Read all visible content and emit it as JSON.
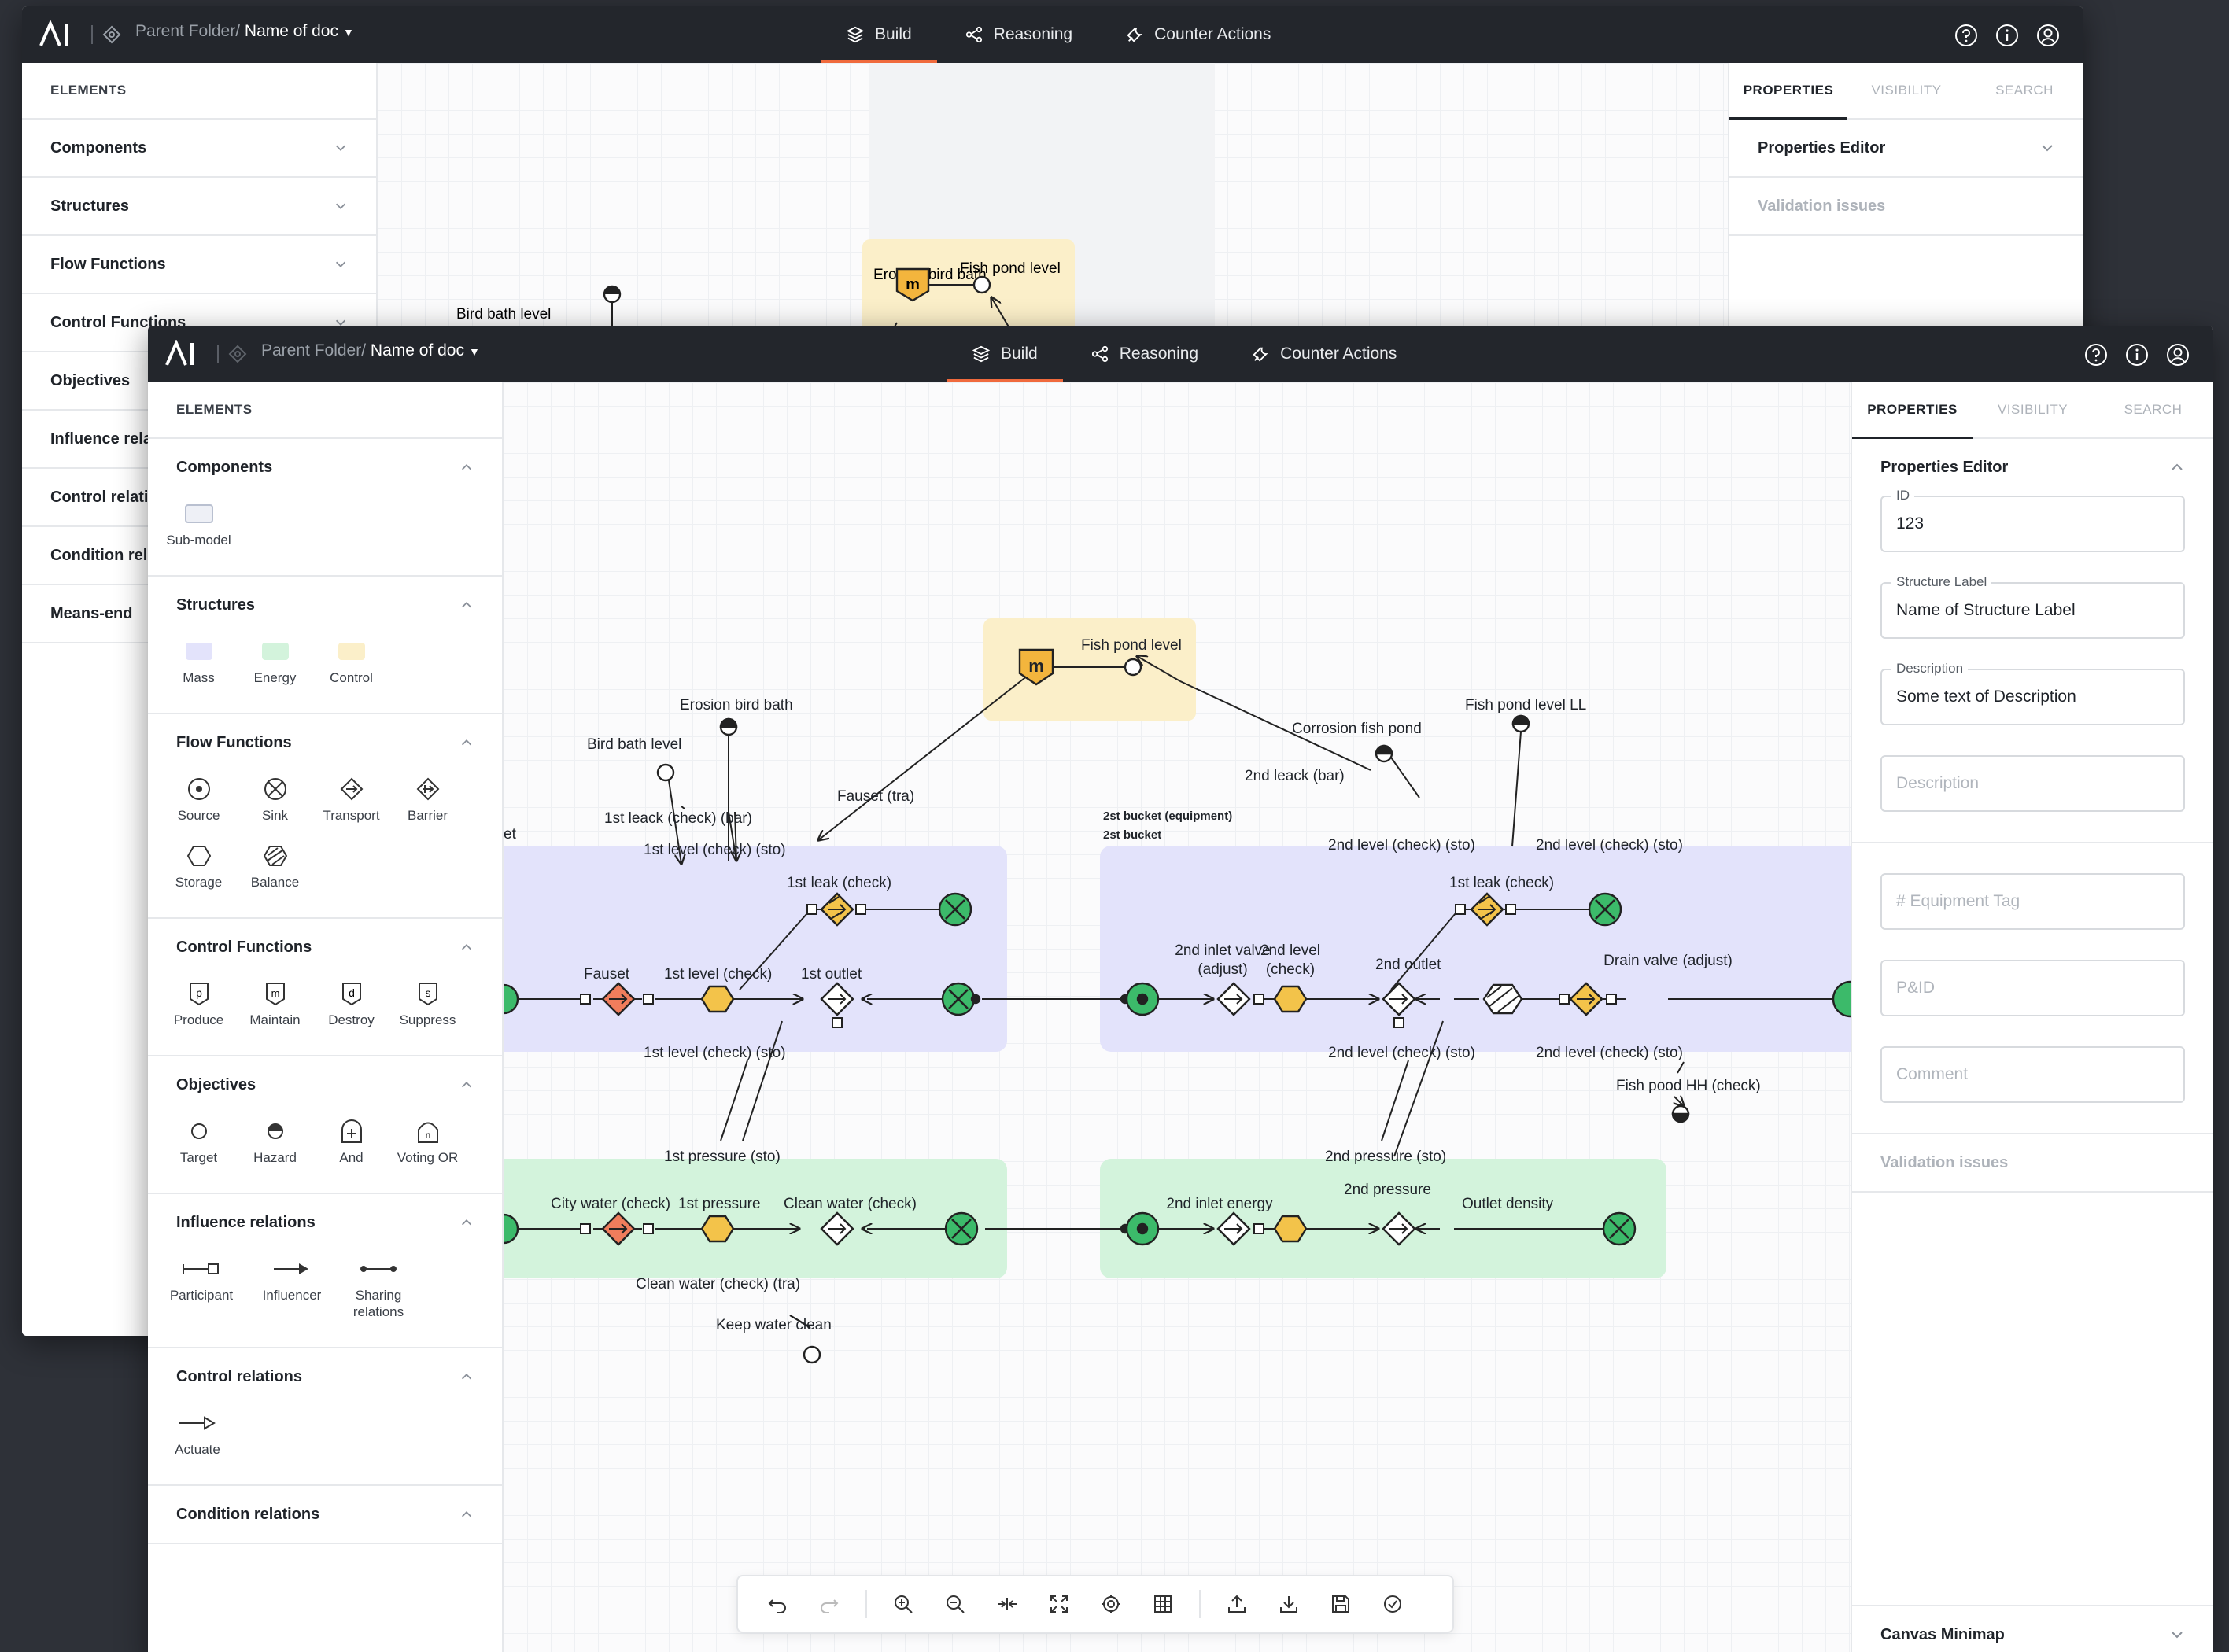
{
  "app": {
    "breadcrumb_parent": "Parent Folder/",
    "doc_name": "Name of doc"
  },
  "nav_tabs": [
    {
      "label": "Build",
      "active": true
    },
    {
      "label": "Reasoning",
      "active": false
    },
    {
      "label": "Counter Actions",
      "active": false
    }
  ],
  "header_icons": [
    "help-icon",
    "info-icon",
    "account-icon"
  ],
  "accent": "#f06a3d",
  "back_window": {
    "elements_title": "ELEMENTS",
    "sections": [
      "Components",
      "Structures",
      "Flow Functions",
      "Control Functions",
      "Objectives",
      "Influence rela",
      "Control relati",
      "Condition rela",
      "Means-end"
    ],
    "right_tabs": [
      "PROPERTIES",
      "VISIBILITY",
      "SEARCH"
    ],
    "properties_editor": "Properties Editor",
    "validation": "Validation issues",
    "canvas_labels": {
      "erosion": "Erosion bird bath",
      "bird_bath": "Bird bath level",
      "fish_pond": "Fish pond level"
    }
  },
  "left_panel": {
    "title": "ELEMENTS",
    "components": {
      "title": "Components",
      "items": [
        {
          "label": "Sub-model"
        }
      ]
    },
    "structures": {
      "title": "Structures",
      "items": [
        {
          "label": "Mass",
          "color": "#e3e3fb"
        },
        {
          "label": "Energy",
          "color": "#d3f3dc"
        },
        {
          "label": "Control",
          "color": "#fbefc9"
        }
      ]
    },
    "flow_functions": {
      "title": "Flow Functions",
      "items": [
        "Source",
        "Sink",
        "Transport",
        "Barrier",
        "Storage",
        "Balance"
      ]
    },
    "control_functions": {
      "title": "Control Functions",
      "items": [
        "Produce",
        "Maintain",
        "Destroy",
        "Suppress"
      ]
    },
    "objectives": {
      "title": "Objectives",
      "items": [
        "Target",
        "Hazard",
        "And",
        "Voting OR"
      ]
    },
    "influence_relations": {
      "title": "Influence relations",
      "items": [
        "Participant",
        "Influencer",
        "Sharing relations"
      ]
    },
    "control_relations": {
      "title": "Control relations",
      "items": [
        "Actuate"
      ]
    },
    "condition_relations": {
      "title": "Condition relations"
    }
  },
  "right_panel": {
    "tabs": [
      "PROPERTIES",
      "VISIBILITY",
      "SEARCH"
    ],
    "properties_editor": "Properties Editor",
    "fields": {
      "id": {
        "label": "ID",
        "value": "123"
      },
      "structure_label": {
        "label": "Structure Label",
        "value": "Name of Structure Label"
      },
      "description": {
        "label": "Description",
        "value": "Some text of Description"
      },
      "description2": {
        "placeholder": "Description"
      },
      "equipment_tag": {
        "placeholder": "# Equipment Tag"
      },
      "pid": {
        "placeholder": "P&ID"
      },
      "comment": {
        "placeholder": "Comment"
      }
    },
    "validation": "Validation issues",
    "minimap": "Canvas Minimap"
  },
  "canvas": {
    "fish_pond_level": "Fish pond level",
    "erosion_bird_bath": "Erosion bird bath",
    "bird_bath_level": "Bird bath level",
    "fauset_tra": "Fauset (tra)",
    "leak_bar_1": "1st leack (check) (bar)",
    "level_sto_1_top": "1st level (check) (sto)",
    "bucket_equipment": "2st bucket (equipment)",
    "bucket": "2st bucket",
    "corrosion": "Corrosion fish pond",
    "leak_bar_2": "2nd leack (bar)",
    "fish_pond_ll": "Fish pond level LL",
    "level_sto_2_top": "2nd level (check) (sto)",
    "level_sto_2_top_b": "2nd level (check) (sto)",
    "leak_check_1": "1st leak (check)",
    "fauset": "Fauset",
    "level_check_1": "1st level (check)",
    "outlet_1": "1st outlet",
    "leak_check_2": "1st leak (check)",
    "inlet_valve_2": "2nd inlet valve",
    "adjust": "(adjust)",
    "level_2": "2nd level",
    "check": "(check)",
    "outlet_2": "2nd outlet",
    "drain_valve": "Drain valve (adjust)",
    "level_sto_1_bottom": "1st level (check) (sto)",
    "level_sto_2_bottom": "2nd level (check) (sto)",
    "level_sto_2_bottom_b": "2nd level (check) (sto)",
    "fish_pond_hh": "Fish pood HH (check)",
    "pressure_sto_1": "1st pressure (sto)",
    "pressure_sto_2": "2nd pressure (sto)",
    "city_water": "City water (check)",
    "pressure_1": "1st pressure",
    "clean_water": "Clean water (check)",
    "inlet_energy": "2nd inlet energy",
    "pressure_2": "2nd pressure",
    "outlet_density": "Outlet density",
    "clean_water_tra": "Clean water (check) (tra)",
    "keep_water_clean": "Keep water clean",
    "edge_label": "et"
  },
  "toolbar": [
    "undo-icon",
    "redo-icon",
    "zoom-in-icon",
    "zoom-out-icon",
    "collapse-icon",
    "fit-screen-icon",
    "center-icon",
    "grid-icon",
    "upload-icon",
    "download-icon",
    "save-icon",
    "validate-icon"
  ]
}
